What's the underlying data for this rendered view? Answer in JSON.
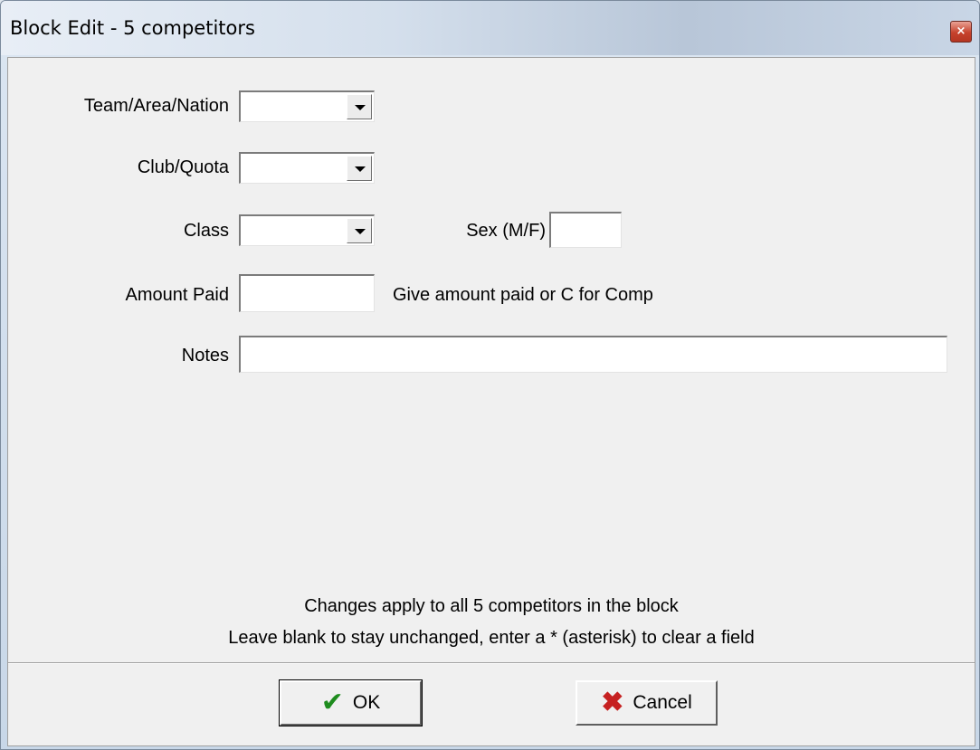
{
  "window": {
    "title": "Block Edit - 5 competitors",
    "close_glyph": "×"
  },
  "form": {
    "team_label": "Team/Area/Nation",
    "team_value": "",
    "club_label": "Club/Quota",
    "club_value": "",
    "class_label": "Class",
    "class_value": "",
    "sex_label": "Sex (M/F)",
    "sex_value": "",
    "amount_label": "Amount Paid",
    "amount_value": "",
    "amount_hint": "Give amount paid or C for Comp",
    "notes_label": "Notes",
    "notes_value": ""
  },
  "info": {
    "line1": "Changes apply to all 5 competitors in the block",
    "line2": "Leave blank to stay unchanged, enter a * (asterisk) to clear a field"
  },
  "buttons": {
    "ok_label": "OK",
    "ok_icon": "✔",
    "cancel_label": "Cancel",
    "cancel_icon": "✖"
  },
  "colors": {
    "ok_icon": "#1e8c1e",
    "cancel_icon": "#c62121"
  }
}
